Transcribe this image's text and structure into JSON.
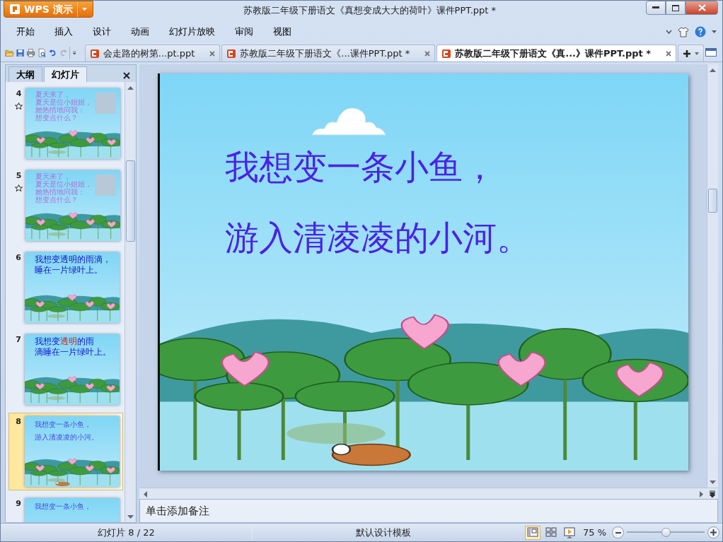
{
  "app_button": {
    "label": "WPS 演示"
  },
  "window": {
    "title": "苏教版二年级下册语文《真想变成大大的荷叶》课件PPT.ppt *"
  },
  "menu": [
    "开始",
    "插入",
    "设计",
    "动画",
    "幻灯片放映",
    "审阅",
    "视图"
  ],
  "doc_tabs": [
    {
      "label": "会走路的树第...pt.ppt",
      "selected": false
    },
    {
      "label": "苏教版二年级下册语文《...课件PPT.ppt *",
      "selected": false
    },
    {
      "label": "苏教版二年级下册语文《真...》课件PPT.ppt *",
      "selected": true
    }
  ],
  "panel_tabs": [
    {
      "label": "大纲",
      "selected": false
    },
    {
      "label": "幻灯片",
      "selected": true
    }
  ],
  "slides": [
    {
      "number": "4",
      "animated": true,
      "kind": "photo",
      "selected": false,
      "lines": [
        [
          "夏天来了，"
        ],
        [
          "夏天是位小姐姐，"
        ],
        [
          "她热情地问我："
        ],
        [
          "想变点什么？"
        ]
      ]
    },
    {
      "number": "5",
      "animated": true,
      "kind": "photo",
      "selected": false,
      "lines": [
        [
          "夏天来了，"
        ],
        [
          "夏天是位小姐姐，"
        ],
        [
          "她热情地问我："
        ],
        [
          "想变点什么？"
        ]
      ]
    },
    {
      "number": "6",
      "animated": false,
      "kind": "big",
      "selected": false,
      "lines": [
        [
          "我想变透明的雨滴，"
        ],
        [
          "睡在一片绿叶上。"
        ]
      ]
    },
    {
      "number": "7",
      "animated": false,
      "kind": "big",
      "selected": false,
      "lines": [
        [
          "我想变",
          {
            "text": "透明",
            "emphasis": true
          },
          "的雨"
        ],
        [
          "滴睡在一片绿叶上。"
        ]
      ]
    },
    {
      "number": "8",
      "animated": false,
      "kind": "small",
      "selected": true,
      "lines": [
        [
          "我想变一条小鱼，"
        ],
        [
          "游入清凌凌的小河。"
        ]
      ]
    },
    {
      "number": "9",
      "animated": false,
      "kind": "small",
      "selected": false,
      "lines": [
        [
          "我想变一条小鱼，"
        ]
      ]
    }
  ],
  "current_slide": {
    "lines": [
      "我想变一条小鱼，",
      "游入清凌凌的小河。"
    ]
  },
  "notes": {
    "text": "单击添加备注"
  },
  "status_bar": {
    "slide_counter": "幻灯片 8 / 22",
    "template": "默认设计模板",
    "views": [
      {
        "selected": true
      },
      {
        "selected": false
      },
      {
        "selected": false
      }
    ],
    "zoom": "75 %",
    "zoom_slider": {
      "level": 0.5
    }
  }
}
